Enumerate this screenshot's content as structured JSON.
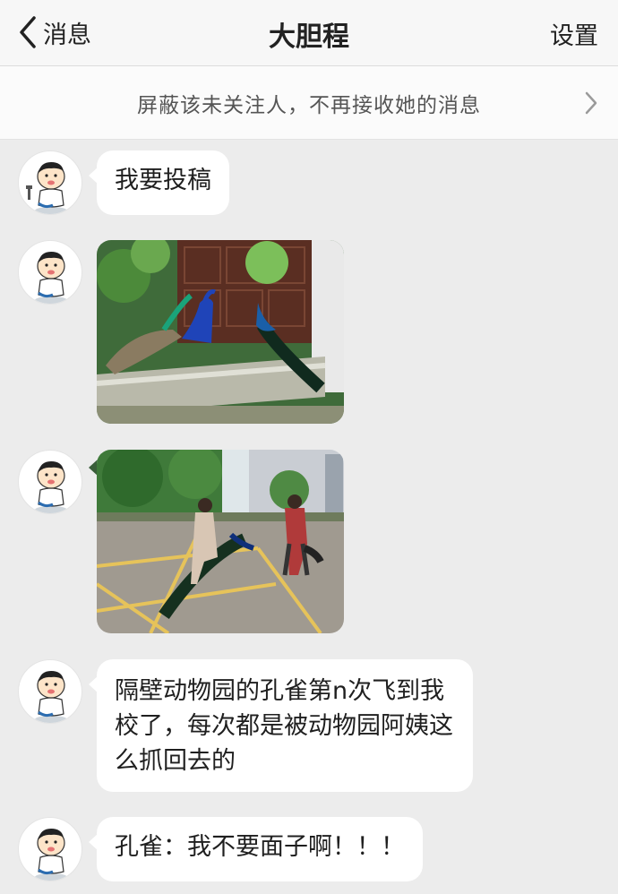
{
  "navbar": {
    "back_label": "消息",
    "title": "大胆程",
    "settings_label": "设置"
  },
  "block_notice": "屏蔽该未关注人，不再接收她的消息",
  "messages": [
    {
      "type": "text",
      "text": "我要投稿"
    },
    {
      "type": "image",
      "icon": "peacocks-on-wall-photo"
    },
    {
      "type": "image",
      "icon": "peacock-caught-street-photo"
    },
    {
      "type": "text",
      "text": "隔壁动物园的孔雀第n次飞到我校了，每次都是被动物园阿姨这么抓回去的"
    },
    {
      "type": "text",
      "text": "孔雀：我不要面子啊！！！"
    }
  ],
  "colors": {
    "background": "#ececec",
    "bubble": "#ffffff",
    "navbar": "#f7f7f7"
  }
}
